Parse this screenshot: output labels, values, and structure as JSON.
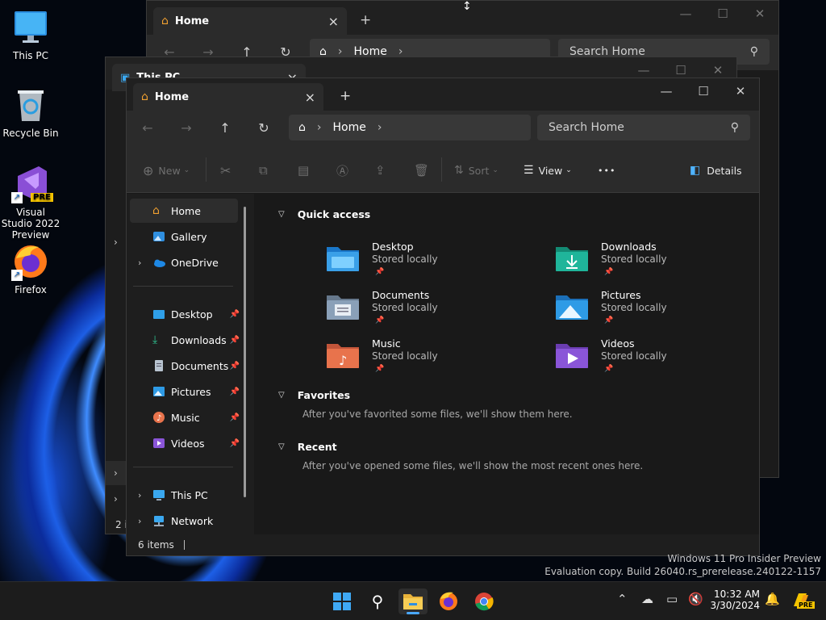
{
  "desktop": {
    "icons": [
      {
        "label": "This PC"
      },
      {
        "label": "Recycle Bin"
      },
      {
        "label": "Visual Studio 2022 Preview",
        "badge": "PRE"
      },
      {
        "label": "Firefox"
      }
    ]
  },
  "back_window_1": {
    "tab_title": "Home",
    "address": "Home",
    "search_placeholder": "Search Home"
  },
  "back_window_2": {
    "tab_title": "This PC",
    "status_fragment": "2 i"
  },
  "window": {
    "tab_title": "Home",
    "new_tab": "+",
    "address": "Home",
    "search_placeholder": "Search Home",
    "toolbar": {
      "new_label": "New",
      "sort_label": "Sort",
      "view_label": "View",
      "more_label": "•••",
      "details_label": "Details"
    },
    "nav": {
      "home": "Home",
      "gallery": "Gallery",
      "onedrive": "OneDrive",
      "desktop": "Desktop",
      "downloads": "Downloads",
      "documents": "Documents",
      "pictures": "Pictures",
      "music": "Music",
      "videos": "Videos",
      "thispc": "This PC",
      "network": "Network"
    },
    "quick_access": {
      "title": "Quick access",
      "items": [
        {
          "name": "Desktop",
          "sub": "Stored locally",
          "color": "#3aa0e8"
        },
        {
          "name": "Downloads",
          "sub": "Stored locally",
          "color": "#1fb59a"
        },
        {
          "name": "Documents",
          "sub": "Stored locally",
          "color": "#8aa0b8"
        },
        {
          "name": "Pictures",
          "sub": "Stored locally",
          "color": "#2e9be6"
        },
        {
          "name": "Music",
          "sub": "Stored locally",
          "color": "#e8734c"
        },
        {
          "name": "Videos",
          "sub": "Stored locally",
          "color": "#8a55d8"
        }
      ]
    },
    "favorites": {
      "title": "Favorites",
      "hint": "After you've favorited some files, we'll show them here."
    },
    "recent": {
      "title": "Recent",
      "hint": "After you've opened some files, we'll show the most recent ones here."
    },
    "status": "6 items"
  },
  "watermark": {
    "line1": "Windows 11 Pro Insider Preview",
    "line2": "Evaluation copy. Build 26040.rs_prerelease.240122-1157"
  },
  "taskbar": {
    "time": "10:32 AM",
    "date": "3/30/2024",
    "copilot_badge": "PRE"
  }
}
